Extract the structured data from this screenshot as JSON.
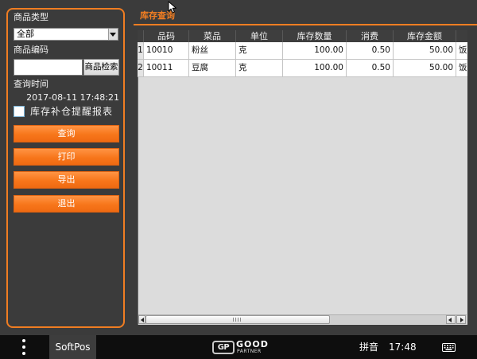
{
  "colors": {
    "accent": "#f07d22",
    "background": "#3b3b3b",
    "taskbar": "#0e0e0e",
    "table_background": "#dcdcdc",
    "button_orange": "#f7761b"
  },
  "icons": {
    "dropdown": "chevron-down-icon",
    "menu": "more-vertical-icon",
    "keyboard": "keyboard-icon",
    "scroll_left": "arrow-left-icon",
    "scroll_right": "arrow-right-icon",
    "scroll_grip": "grip-icon",
    "cursor": "mouse-pointer-icon"
  },
  "sidebar": {
    "category": {
      "label": "商品类型",
      "selected": "全部"
    },
    "code": {
      "label": "商品编码",
      "value": "",
      "search_button": "商品检索"
    },
    "query_time": {
      "label": "查询时间",
      "value": "2017-08-11 17:48:21"
    },
    "reminder": {
      "label": "库存补仓提醒报表",
      "checked": false
    },
    "actions": [
      "查询",
      "打印",
      "导出",
      "退出"
    ]
  },
  "main": {
    "title": "库存查询",
    "table": {
      "columns": [
        "品码",
        "菜品",
        "单位",
        "库存数量",
        "消费",
        "库存金额"
      ],
      "rows": [
        {
          "index": "1",
          "code": "10010",
          "name": "粉丝",
          "unit": "克",
          "quantity": "100.00",
          "consumption": "0.50",
          "amount": "50.00",
          "partial_next": "饭"
        },
        {
          "index": "2",
          "code": "10011",
          "name": "豆腐",
          "unit": "克",
          "quantity": "100.00",
          "consumption": "0.50",
          "amount": "50.00",
          "partial_next": "饭"
        }
      ]
    }
  },
  "taskbar": {
    "app_tab": "SoftPos",
    "logo": {
      "mark": "GP",
      "top": "GOOD",
      "bottom": "PARTNER"
    },
    "input_method": "拼音",
    "clock": "17:48"
  }
}
